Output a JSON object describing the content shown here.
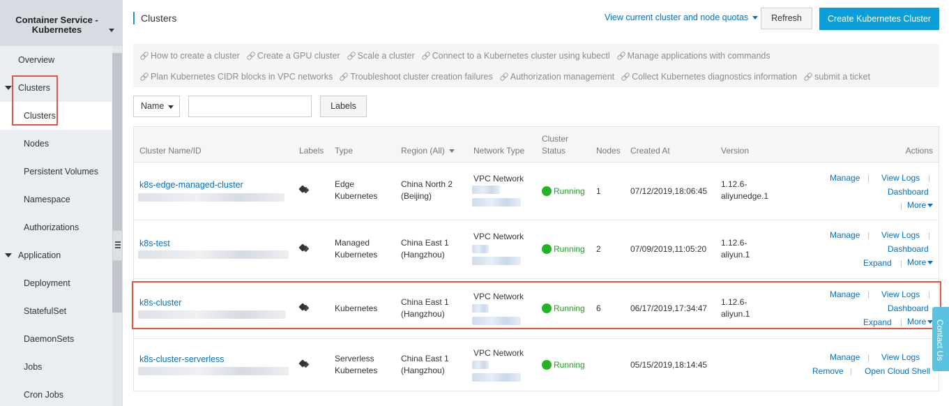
{
  "sidebar": {
    "brand": "Container Service - Kubernetes",
    "items": [
      {
        "label": "Overview"
      },
      {
        "label": "Clusters"
      },
      {
        "label": "Clusters"
      },
      {
        "label": "Nodes"
      },
      {
        "label": "Persistent Volumes"
      },
      {
        "label": "Namespace"
      },
      {
        "label": "Authorizations"
      },
      {
        "label": "Application"
      },
      {
        "label": "Deployment"
      },
      {
        "label": "StatefulSet"
      },
      {
        "label": "DaemonSets"
      },
      {
        "label": "Jobs"
      },
      {
        "label": "Cron Jobs"
      }
    ]
  },
  "header": {
    "title": "Clusters",
    "quota_link": "View current cluster and node quotas",
    "refresh_label": "Refresh",
    "create_label": "Create Kubernetes Cluster"
  },
  "help_links": {
    "row1": [
      "How to create a cluster",
      "Create a GPU cluster",
      "Scale a cluster",
      "Connect to a Kubernetes cluster using kubectl",
      "Manage applications with commands"
    ],
    "row2": [
      "Plan Kubernetes CIDR blocks in VPC networks",
      "Troubleshoot cluster creation failures",
      "Authorization management",
      "Collect Kubernetes diagnostics information",
      "submit a ticket"
    ]
  },
  "filter": {
    "select_value": "Name",
    "search_value": "",
    "labels_button": "Labels"
  },
  "table": {
    "columns": {
      "name": "Cluster Name/ID",
      "labels": "Labels",
      "type": "Type",
      "region": "Region (All)",
      "network": "Network Type",
      "status_line1": "Cluster",
      "status_line2": "Status",
      "nodes": "Nodes",
      "created": "Created At",
      "version": "Version",
      "actions": "Actions"
    },
    "rows": [
      {
        "name": "k8s-edge-managed-cluster",
        "type_line1": "Edge",
        "type_line2": "Kubernetes",
        "region_line1": "China North 2",
        "region_line2": "(Beijing)",
        "network": "VPC Network",
        "status": "Running",
        "nodes": "1",
        "created": "07/12/2019,18:06:45",
        "version_line1": "1.12.6-",
        "version_line2": "aliyunedge.1",
        "actions": {
          "manage": "Manage",
          "logs": "View Logs",
          "dashboard": "Dashboard",
          "more": "More"
        }
      },
      {
        "name": "k8s-test",
        "type_line1": "Managed",
        "type_line2": "Kubernetes",
        "region_line1": "China East 1",
        "region_line2": "(Hangzhou)",
        "network": "VPC Network",
        "status": "Running",
        "nodes": "2",
        "created": "07/09/2019,11:05:20",
        "version_line1": "1.12.6-",
        "version_line2": "aliyun.1",
        "actions": {
          "manage": "Manage",
          "logs": "View Logs",
          "dashboard": "Dashboard",
          "expand": "Expand",
          "more": "More"
        }
      },
      {
        "name": "k8s-cluster",
        "type_line1": "Kubernetes",
        "region_line1": "China East 1",
        "region_line2": "(Hangzhou)",
        "network": "VPC Network",
        "status": "Running",
        "nodes": "6",
        "created": "06/17/2019,17:34:47",
        "version_line1": "1.12.6-",
        "version_line2": "aliyun.1",
        "actions": {
          "manage": "Manage",
          "logs": "View Logs",
          "dashboard": "Dashboard",
          "expand": "Expand",
          "more": "More"
        }
      },
      {
        "name": "k8s-cluster-serverless",
        "type_line1": "Serverless",
        "type_line2": "Kubernetes",
        "region_line1": "China East 1",
        "region_line2": "(Hangzhou)",
        "network": "VPC Network",
        "status": "Running",
        "created": "05/15/2019,18:14:45",
        "actions": {
          "manage": "Manage",
          "logs": "View Logs",
          "remove": "Remove",
          "cloud_shell": "Open Cloud Shell"
        }
      }
    ]
  },
  "contact_tab": "Contact Us",
  "colors": {
    "accent": "#0a9edb",
    "link": "#0070cc",
    "running": "#22b422",
    "highlight": "#e8553e"
  }
}
